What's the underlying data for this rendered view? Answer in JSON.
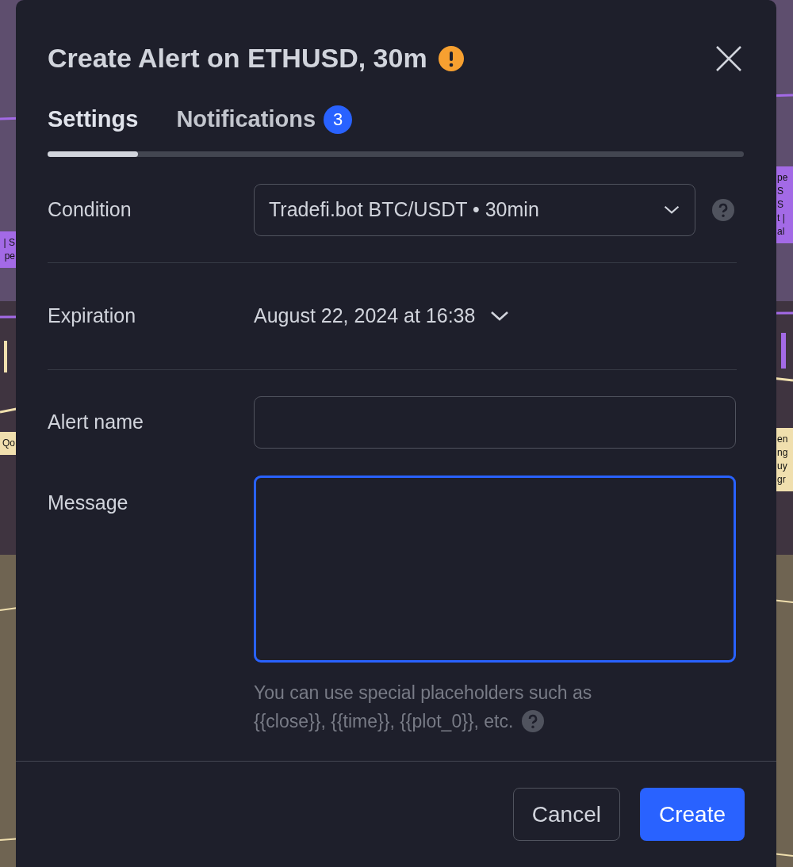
{
  "chart_tags": [
    {
      "kind": "left",
      "color": "#a36ae6",
      "lines": [
        "| S",
        "pe"
      ]
    },
    {
      "kind": "left",
      "color": "#f0dfae",
      "lines": [
        "Qo"
      ]
    },
    {
      "kind": "right",
      "color": "#a36ae6",
      "lines": [
        "pe",
        "S",
        "S",
        "t |",
        "al"
      ]
    },
    {
      "kind": "right",
      "color": "#f0dfae",
      "lines": [
        "en",
        "ng",
        "uy",
        "gr"
      ]
    }
  ],
  "dialog": {
    "title": "Create Alert on ETHUSD, 30m",
    "tabs": [
      {
        "label": "Settings",
        "selected": true
      },
      {
        "label": "Notifications",
        "selected": false,
        "count": "3"
      }
    ],
    "rows": [
      {
        "kind": "select",
        "label": "Condition",
        "value": "Tradefi.bot BTC/USDT • 30min"
      },
      {
        "kind": "dropdown",
        "label": "Expiration",
        "value": "August 22, 2024 at 16:38"
      },
      {
        "kind": "input",
        "label": "Alert name",
        "focused": false
      },
      {
        "kind": "textarea",
        "label": "Message",
        "focused": true
      }
    ],
    "hint_lines": [
      "You can use special placeholders such as",
      "{{close}}, {{time}}, {{plot_0}}, etc."
    ],
    "buttons": [
      {
        "label": "Cancel",
        "kind": "secondary"
      },
      {
        "label": "Create",
        "kind": "primary"
      }
    ]
  }
}
